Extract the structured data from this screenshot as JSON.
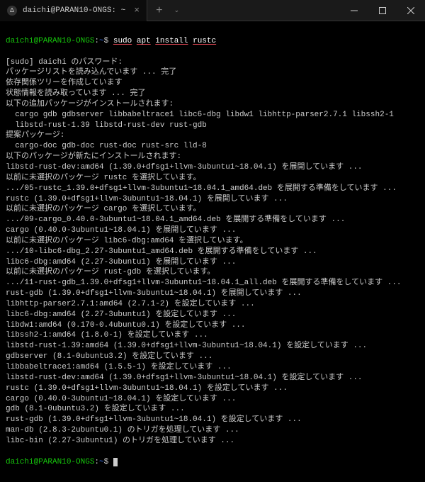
{
  "titlebar": {
    "tab_title": "daichi@PARAN10-ONGS: ~",
    "tab_icon": "Δ"
  },
  "prompt": {
    "user_host": "daichi@PARAN10-ONGS",
    "path": "~",
    "sep1": ":",
    "sep2": "$"
  },
  "command": {
    "part1": "sudo",
    "part2": "apt",
    "part3": "install",
    "part4": "rustc"
  },
  "lines": [
    "[sudo] daichi のパスワード:",
    "パッケージリストを読み込んでいます ... 完了",
    "依存関係ツリーを作成しています",
    "状態情報を読み取っています ... 完了",
    "以下の追加パッケージがインストールされます:",
    "  cargo gdb gdbserver libbabeltrace1 libc6-dbg libdw1 libhttp-parser2.7.1 libssh2-1",
    "  libstd-rust-1.39 libstd-rust-dev rust-gdb",
    "提案パッケージ:",
    "  cargo-doc gdb-doc rust-doc rust-src lld-8",
    "以下のパッケージが新たにインストールされます:",
    "libstd-rust-dev:amd64 (1.39.0+dfsg1+llvm-3ubuntu1~18.04.1) を展開しています ...",
    "以前に未選択のパッケージ rustc を選択しています。",
    ".../05-rustc_1.39.0+dfsg1+llvm-3ubuntu1~18.04.1_amd64.deb を展開する準備をしています ...",
    "rustc (1.39.0+dfsg1+llvm-3ubuntu1~18.04.1) を展開しています ...",
    "以前に未選択のパッケージ cargo を選択しています。",
    ".../09-cargo_0.40.0-3ubuntu1~18.04.1_amd64.deb を展開する準備をしています ...",
    "cargo (0.40.0-3ubuntu1~18.04.1) を展開しています ...",
    "以前に未選択のパッケージ libc6-dbg:amd64 を選択しています。",
    ".../10-libc6-dbg_2.27-3ubuntu1_amd64.deb を展開する準備をしています ...",
    "libc6-dbg:amd64 (2.27-3ubuntu1) を展開しています ...",
    "以前に未選択のパッケージ rust-gdb を選択しています。",
    ".../11-rust-gdb_1.39.0+dfsg1+llvm-3ubuntu1~18.04.1_all.deb を展開する準備をしています ...",
    "rust-gdb (1.39.0+dfsg1+llvm-3ubuntu1~18.04.1) を展開しています ...",
    "libhttp-parser2.7.1:amd64 (2.7.1-2) を設定しています ...",
    "libc6-dbg:amd64 (2.27-3ubuntu1) を設定しています ...",
    "libdw1:amd64 (0.170-0.4ubuntu0.1) を設定しています ...",
    "libssh2-1:amd64 (1.8.0-1) を設定しています ...",
    "libstd-rust-1.39:amd64 (1.39.0+dfsg1+llvm-3ubuntu1~18.04.1) を設定しています ...",
    "gdbserver (8.1-0ubuntu3.2) を設定しています ...",
    "libbabeltrace1:amd64 (1.5.5-1) を設定しています ...",
    "libstd-rust-dev:amd64 (1.39.0+dfsg1+llvm-3ubuntu1~18.04.1) を設定しています ...",
    "rustc (1.39.0+dfsg1+llvm-3ubuntu1~18.04.1) を設定しています ...",
    "cargo (0.40.0-3ubuntu1~18.04.1) を設定しています ...",
    "gdb (8.1-0ubuntu3.2) を設定しています ...",
    "rust-gdb (1.39.0+dfsg1+llvm-3ubuntu1~18.04.1) を設定しています ...",
    "man-db (2.8.3-2ubuntu0.1) のトリガを処理しています ...",
    "libc-bin (2.27-3ubuntu1) のトリガを処理しています ..."
  ]
}
